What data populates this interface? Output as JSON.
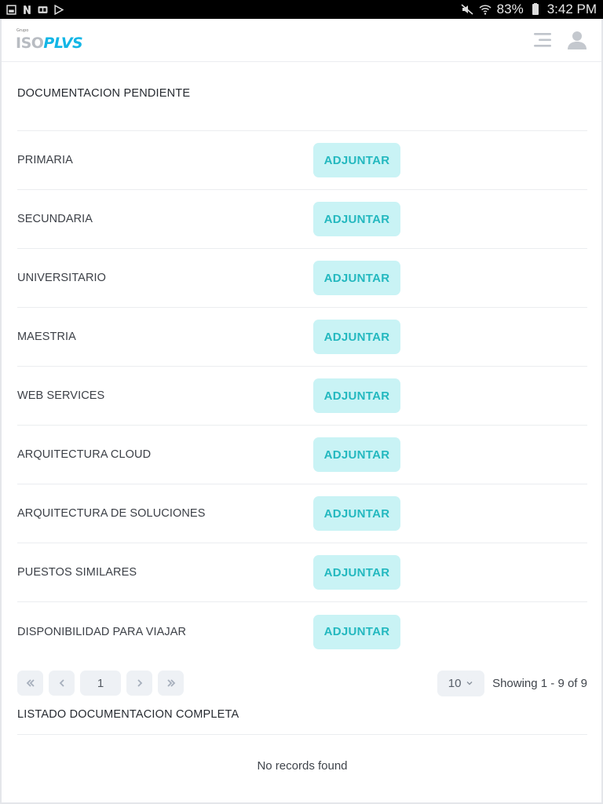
{
  "status_bar": {
    "battery": "83%",
    "time": "3:42 PM"
  },
  "header": {
    "logo_small": "Grupo",
    "logo_iso": "ISO",
    "logo_plus": "PLVS"
  },
  "pending": {
    "title": "DOCUMENTACION PENDIENTE",
    "button_label": "ADJUNTAR",
    "items": [
      {
        "label": "PRIMARIA"
      },
      {
        "label": "SECUNDARIA"
      },
      {
        "label": "UNIVERSITARIO"
      },
      {
        "label": "MAESTRIA"
      },
      {
        "label": "WEB SERVICES"
      },
      {
        "label": "ARQUITECTURA CLOUD"
      },
      {
        "label": "ARQUITECTURA DE SOLUCIONES"
      },
      {
        "label": "PUESTOS SIMILARES"
      },
      {
        "label": "DISPONIBILIDAD PARA VIAJAR"
      }
    ]
  },
  "pagination": {
    "current_page": "1",
    "page_size": "10",
    "showing": "Showing 1 - 9 of 9"
  },
  "complete": {
    "title": "LISTADO DOCUMENTACION COMPLETA",
    "empty_text": "No records found"
  },
  "icons": {
    "first": "double-chevron-left-icon",
    "prev": "chevron-left-icon",
    "next": "chevron-right-icon",
    "last": "double-chevron-right-icon"
  },
  "colors": {
    "accent_bg": "#c9f3f5",
    "accent_text": "#23b8bf",
    "logo_blue": "#13b6e6"
  }
}
